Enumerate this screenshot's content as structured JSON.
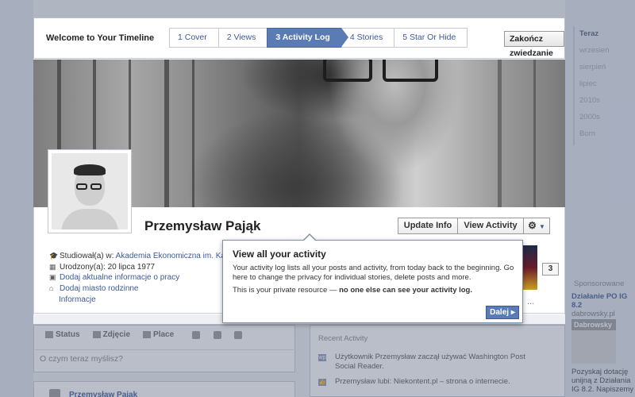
{
  "tour": {
    "title": "Welcome to Your Timeline",
    "steps": [
      {
        "label": "1 Cover",
        "active": false
      },
      {
        "label": "2 Views",
        "active": false
      },
      {
        "label": "3 Activity Log",
        "active": true
      },
      {
        "label": "4 Stories",
        "active": false
      },
      {
        "label": "5 Star Or Hide",
        "active": false
      }
    ],
    "end_label": "Zakończ zwiedzanie"
  },
  "profile": {
    "name": "Przemysław Pająk",
    "update_info": "Update Info",
    "view_activity": "View Activity",
    "gear_icon": "⚙",
    "caret": "▼",
    "info": {
      "studied_prefix": "Studiował(a) w: ",
      "studied_link": "Akademia Ekonomiczna im. Karo",
      "born": "Urodzony(a): 20 lipca 1977",
      "add_work": "Dodaj aktualne informacje o pracy",
      "add_hometown": "Dodaj miasto rodzinne"
    },
    "tab_info": "Informacje",
    "count": "3",
    "more": "..."
  },
  "popover": {
    "title": "View all your activity",
    "body": "Your activity log lists all your posts and activity, from today back to the beginning. Go here to change the privacy for individual stories, delete posts and more.",
    "private_prefix": "This is your private resource — ",
    "private_bold": "no one else can see your activity log.",
    "next": "Dalej ▸"
  },
  "composer": {
    "tabs": [
      "Status",
      "Zdjęcie",
      "Place"
    ],
    "placeholder": "O czym teraz myślisz?",
    "post_author": "Przemysław Pająk"
  },
  "recent": {
    "title": "Recent Activity",
    "items": [
      "Użytkownik Przemysław zaczął używać Washington Post Social Reader.",
      "Przemysław lubi: Niekontent.pl – strona o internecie."
    ]
  },
  "year_nav": [
    "Teraz",
    "wrzesień",
    "sierpień",
    "lipiec",
    "2010s",
    "2000s",
    "Born"
  ],
  "sponsored": {
    "label": "Sponsorowane",
    "ad_title": "Działanie PO IG 8.2",
    "ad_url": "dabrowsky.pl",
    "ad_img_text": "Dabrowsky",
    "ad_text": "Pozyskaj dotację unijną z Działania IG 8.2. Napiszemy"
  },
  "colors": {
    "accent": "#5b7bb5",
    "link": "#3b5998"
  }
}
